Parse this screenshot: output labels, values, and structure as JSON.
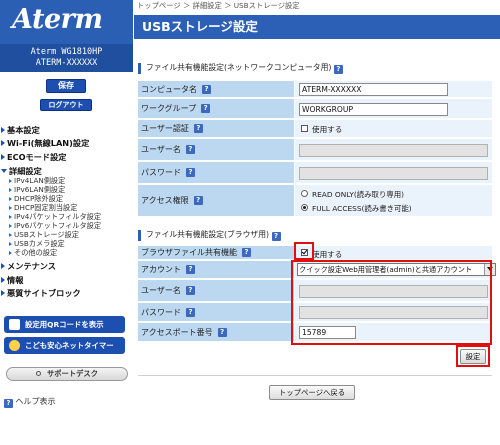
{
  "brand": {
    "logo": "Aterm",
    "model_line1": "Aterm WG1810HP",
    "model_line2": "ATERM-XXXXXX"
  },
  "sidebar": {
    "save_label": "保存",
    "logout_label": "ログアウト",
    "menu": [
      {
        "label": "基本設定"
      },
      {
        "label": "Wi-Fi(無線LAN)設定"
      },
      {
        "label": "ECOモード設定"
      },
      {
        "label": "詳細設定"
      }
    ],
    "sub_items": [
      "IPv4LAN側設定",
      "IPv6LAN側設定",
      "DHCP除外設定",
      "DHCP固定割当設定",
      "IPv4パケットフィルタ設定",
      "IPv6パケットフィルタ設定",
      "USBストレージ設定",
      "USBカメラ設定",
      "その他の設定"
    ],
    "menu_bottom": [
      {
        "label": "メンテナンス"
      },
      {
        "label": "情報"
      },
      {
        "label": "悪質サイトブロック"
      }
    ],
    "qr_button": "設定用QRコードを表示",
    "timer_button": "こども安心ネットタイマー",
    "support_label": "サポートデスク",
    "help_label": "ヘルプ表示"
  },
  "breadcrumb": "トップページ ＞ 詳細設定 ＞ USBストレージ設定",
  "page_title": "USBストレージ設定",
  "network_section": {
    "title": "ファイル共有機能設定(ネットワークコンピュータ用)",
    "computer_name_label": "コンピュータ名",
    "computer_name_value": "ATERM-XXXXXX",
    "workgroup_label": "ワークグループ",
    "workgroup_value": "WORKGROUP",
    "user_auth_label": "ユーザー認証",
    "user_auth_option": "使用する",
    "username_label": "ユーザー名",
    "password_label": "パスワード",
    "access_label": "アクセス権限",
    "access_readonly": "READ ONLY(読み取り専用)",
    "access_full": "FULL ACCESS(読み書き可能)"
  },
  "browser_section": {
    "title": "ファイル共有機能設定(ブラウザ用)",
    "sharing_label": "ブラウザファイル共有機能",
    "sharing_option": "使用する",
    "account_label": "アカウント",
    "account_value": "クイック設定Web用管理者(admin)と共通アカウント",
    "username_label": "ユーザー名",
    "password_label": "パスワード",
    "port_label": "アクセスポート番号",
    "port_value": "15789"
  },
  "help_glyph": "?",
  "apply_label": "設定",
  "back_label": "トップページへ戻る",
  "colors": {
    "primary": "#2c5fb6",
    "label_bg": "#bcd7f0",
    "highlight": "#e01010"
  }
}
